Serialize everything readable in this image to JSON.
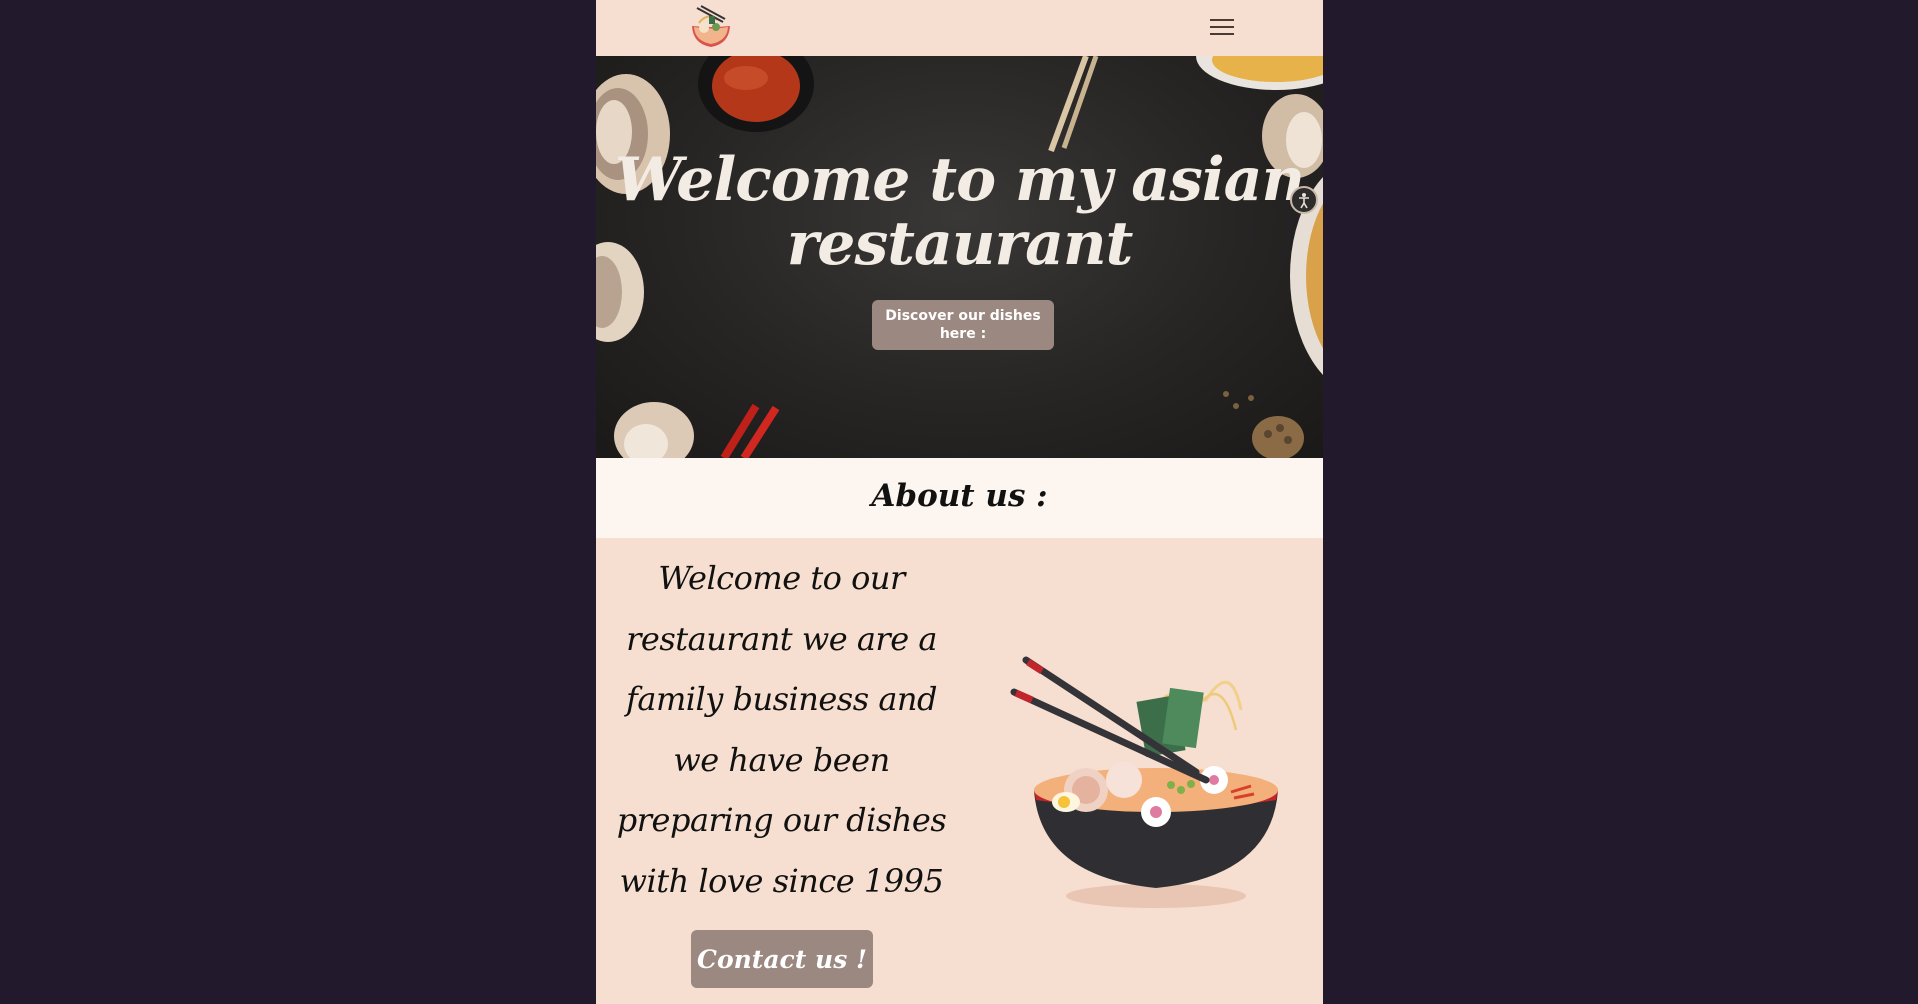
{
  "header": {
    "logo": "ramen-bowl-logo",
    "menu_icon": "hamburger-menu-icon"
  },
  "hero": {
    "title": "Welcome to my asian restaurant",
    "discover_button": "Discover our dishes here :",
    "accessibility_icon": "accessibility-icon"
  },
  "about": {
    "title": "About us :",
    "text": "Welcome to our restaurant we are a family business and we have been preparing our dishes with love since 1995",
    "contact_button": "Contact us !",
    "illustration": "ramen-bowl-illustration"
  },
  "colors": {
    "page_bg": "#221a2c",
    "header_bg": "#f6dfd0",
    "about_band_bg": "#fdf5ef",
    "button_bg": "#9b8880",
    "hero_bg": "#272524"
  }
}
